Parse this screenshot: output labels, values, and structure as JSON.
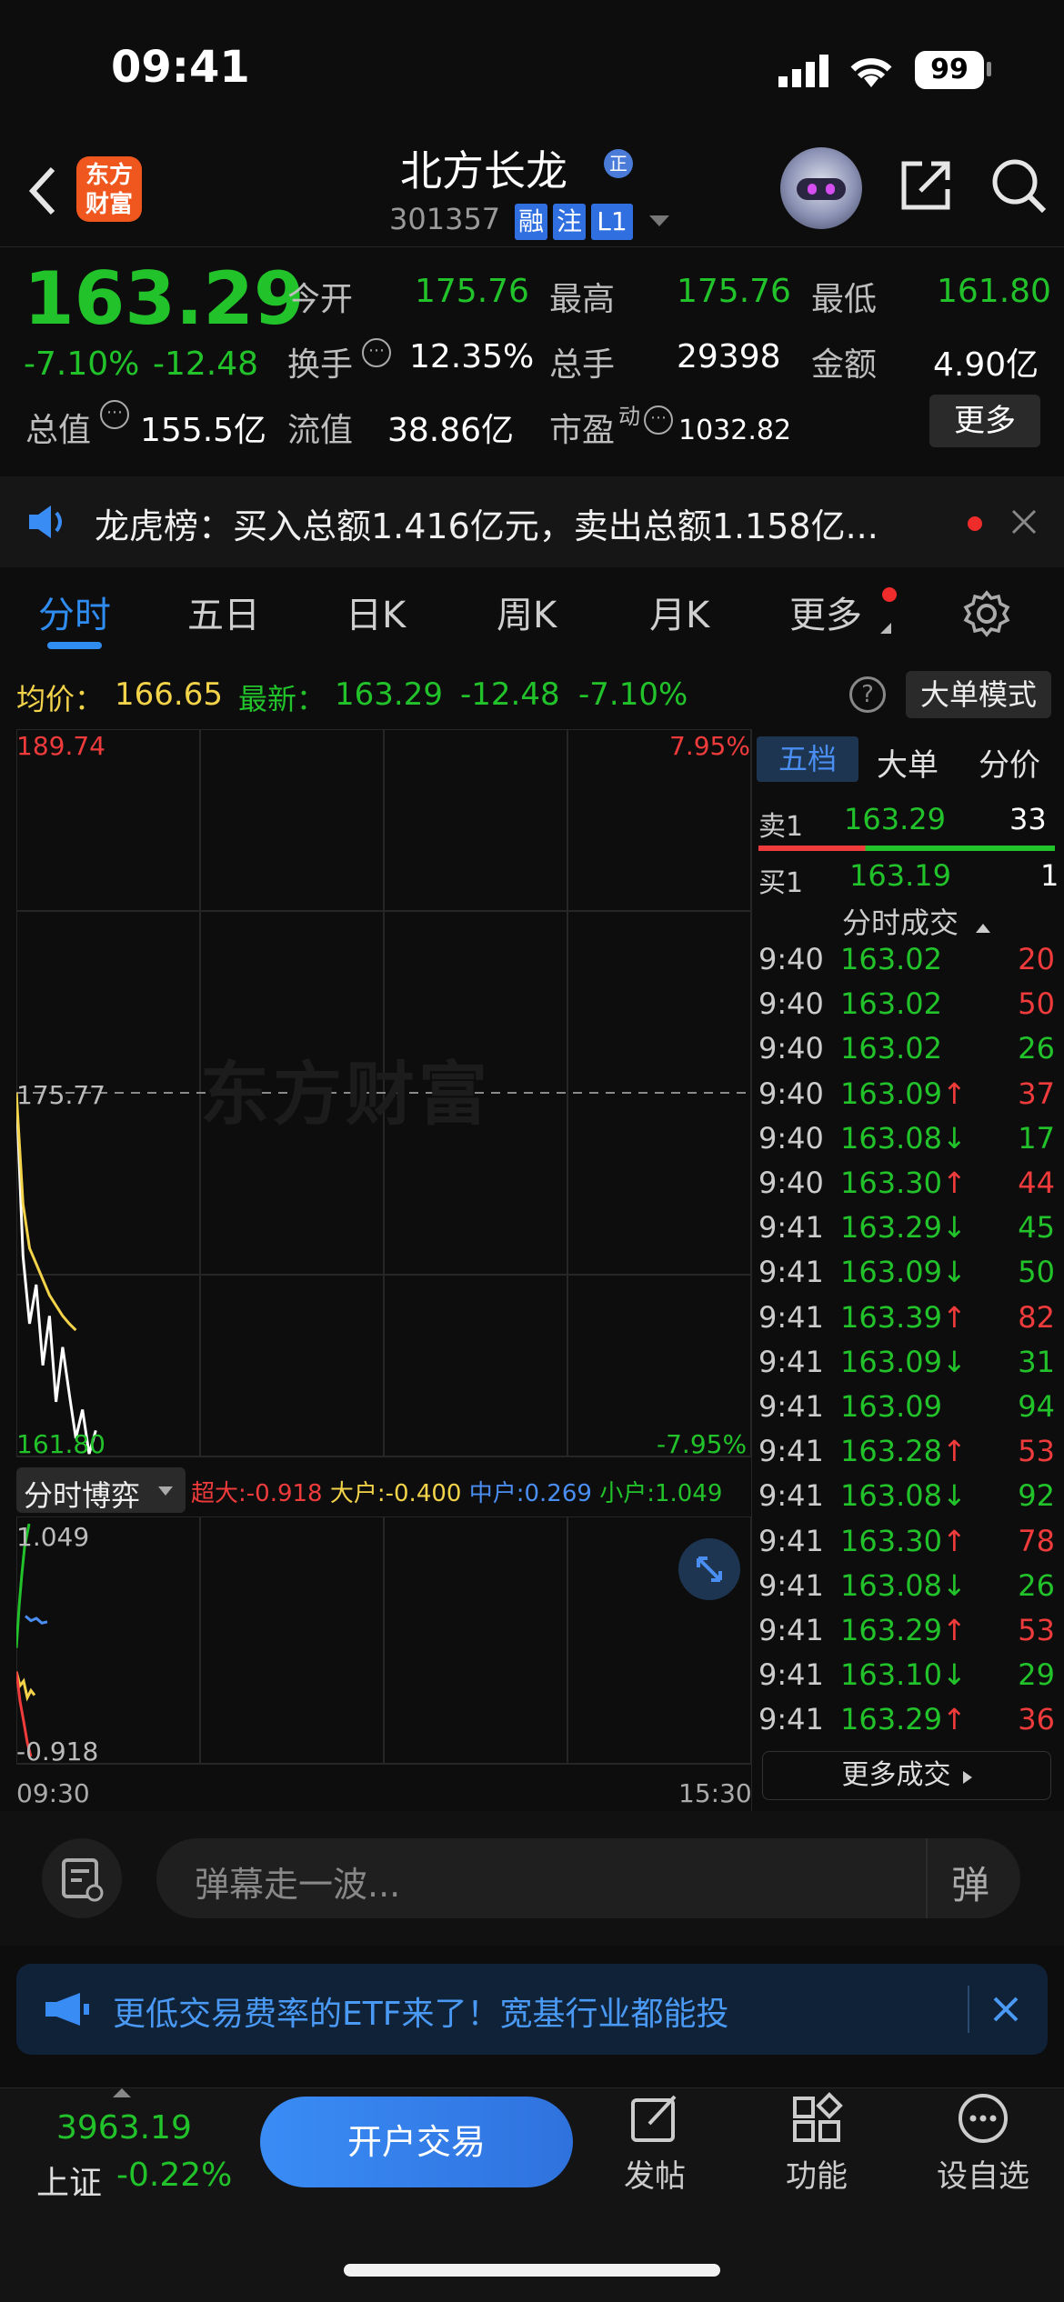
{
  "status": {
    "time": "09:41",
    "battery": "99"
  },
  "header": {
    "logo_text": "东方\n财富",
    "stock_name": "北方长龙",
    "name_badge": "正",
    "stock_code": "301357",
    "tags": [
      "融",
      "注",
      "L1"
    ]
  },
  "quote": {
    "price": "163.29",
    "change_pct": "-7.10%",
    "change": "-12.48",
    "open_label": "今开",
    "open": "175.76",
    "high_label": "最高",
    "high": "175.76",
    "low_label": "最低",
    "low": "161.80",
    "turnover_label": "换手",
    "turnover": "12.35%",
    "volume_label": "总手",
    "volume": "29398",
    "amount_label": "金额",
    "amount": "4.90亿",
    "mktcap_label": "总值",
    "mktcap": "155.5亿",
    "float_label": "流值",
    "float_cap": "38.86亿",
    "pe_label": "市盈",
    "pe_sup": "动",
    "pe": "1032.82",
    "more_label": "更多"
  },
  "banner": {
    "text": "龙虎榜：买入总额1.416亿元，卖出总额1.158亿..."
  },
  "tabs": [
    "分时",
    "五日",
    "日K",
    "周K",
    "月K",
    "更多"
  ],
  "chart_info": {
    "avg_label": "均价：",
    "avg": "166.65",
    "latest_label": "最新：",
    "latest": "163.29",
    "change": "-12.48",
    "change_pct": "-7.10%",
    "mode_btn": "大单模式"
  },
  "chart_data": {
    "type": "line",
    "ylim": [
      161.8,
      189.74
    ],
    "y_top": "189.74",
    "y_mid": "175.77",
    "y_bottom": "161.80",
    "pct_top": "7.95%",
    "pct_bottom": "-7.95%",
    "x_start": "09:30",
    "x_end": "15:30",
    "watermark": "东方财富",
    "series": [
      {
        "values": [
          175.77,
          169.5,
          166.9,
          168.4,
          165.3,
          167.2,
          163.9,
          166.0,
          164.2,
          162.5,
          163.6,
          161.9,
          162.8
        ]
      },
      {
        "values": [
          175.77,
          171.5,
          169.8,
          169.2,
          168.6,
          168.0,
          167.6,
          167.2,
          166.9,
          166.65
        ]
      }
    ]
  },
  "flow": {
    "title": "分时博弈",
    "super_label": "超大:",
    "super": "-0.918",
    "large_label": "大户:",
    "large": "-0.400",
    "mid_label": "中户:",
    "mid": "0.269",
    "small_label": "小户:",
    "small": "1.049",
    "y_top": "1.049",
    "y_bottom": "-0.918"
  },
  "orderbook": {
    "tabs": [
      "五档",
      "大单",
      "分价"
    ],
    "sell1_label": "卖1",
    "sell1_price": "163.29",
    "sell1_vol": "33",
    "buy1_label": "买1",
    "buy1_price": "163.19",
    "buy1_vol": "1",
    "trades_title": "分时成交",
    "more_trades": "更多成交",
    "trades": [
      {
        "time": "9:40",
        "price": "163.02",
        "dir": "",
        "vol": "20",
        "vc": "red"
      },
      {
        "time": "9:40",
        "price": "163.02",
        "dir": "",
        "vol": "50",
        "vc": "red"
      },
      {
        "time": "9:40",
        "price": "163.02",
        "dir": "",
        "vol": "26",
        "vc": "green"
      },
      {
        "time": "9:40",
        "price": "163.09",
        "dir": "↑",
        "vol": "37",
        "vc": "red"
      },
      {
        "time": "9:40",
        "price": "163.08",
        "dir": "↓",
        "vol": "17",
        "vc": "green"
      },
      {
        "time": "9:40",
        "price": "163.30",
        "dir": "↑",
        "vol": "44",
        "vc": "red"
      },
      {
        "time": "9:41",
        "price": "163.29",
        "dir": "↓",
        "vol": "45",
        "vc": "green"
      },
      {
        "time": "9:41",
        "price": "163.09",
        "dir": "↓",
        "vol": "50",
        "vc": "green"
      },
      {
        "time": "9:41",
        "price": "163.39",
        "dir": "↑",
        "vol": "82",
        "vc": "red"
      },
      {
        "time": "9:41",
        "price": "163.09",
        "dir": "↓",
        "vol": "31",
        "vc": "green"
      },
      {
        "time": "9:41",
        "price": "163.09",
        "dir": "",
        "vol": "94",
        "vc": "green"
      },
      {
        "time": "9:41",
        "price": "163.28",
        "dir": "↑",
        "vol": "53",
        "vc": "red"
      },
      {
        "time": "9:41",
        "price": "163.08",
        "dir": "↓",
        "vol": "92",
        "vc": "green"
      },
      {
        "time": "9:41",
        "price": "163.30",
        "dir": "↑",
        "vol": "78",
        "vc": "red"
      },
      {
        "time": "9:41",
        "price": "163.08",
        "dir": "↓",
        "vol": "26",
        "vc": "green"
      },
      {
        "time": "9:41",
        "price": "163.29",
        "dir": "↑",
        "vol": "53",
        "vc": "red"
      },
      {
        "time": "9:41",
        "price": "163.10",
        "dir": "↓",
        "vol": "29",
        "vc": "green"
      },
      {
        "time": "9:41",
        "price": "163.29",
        "dir": "↑",
        "vol": "36",
        "vc": "red"
      }
    ]
  },
  "danmaku": {
    "placeholder": "弹幕走一波...",
    "toggle": "弹"
  },
  "ad": {
    "text": "更低交易费率的ETF来了！宽基行业都能投"
  },
  "bottom": {
    "index_value": "3963.19",
    "index_name": "上证",
    "index_change": "-0.22%",
    "trade_btn": "开户交易",
    "post": "发帖",
    "func": "功能",
    "watch": "设自选"
  },
  "colors": {
    "up": "#ef3b3b",
    "down": "#22c22b",
    "accent": "#2f8cf0",
    "avg_line": "#f3d34a"
  }
}
